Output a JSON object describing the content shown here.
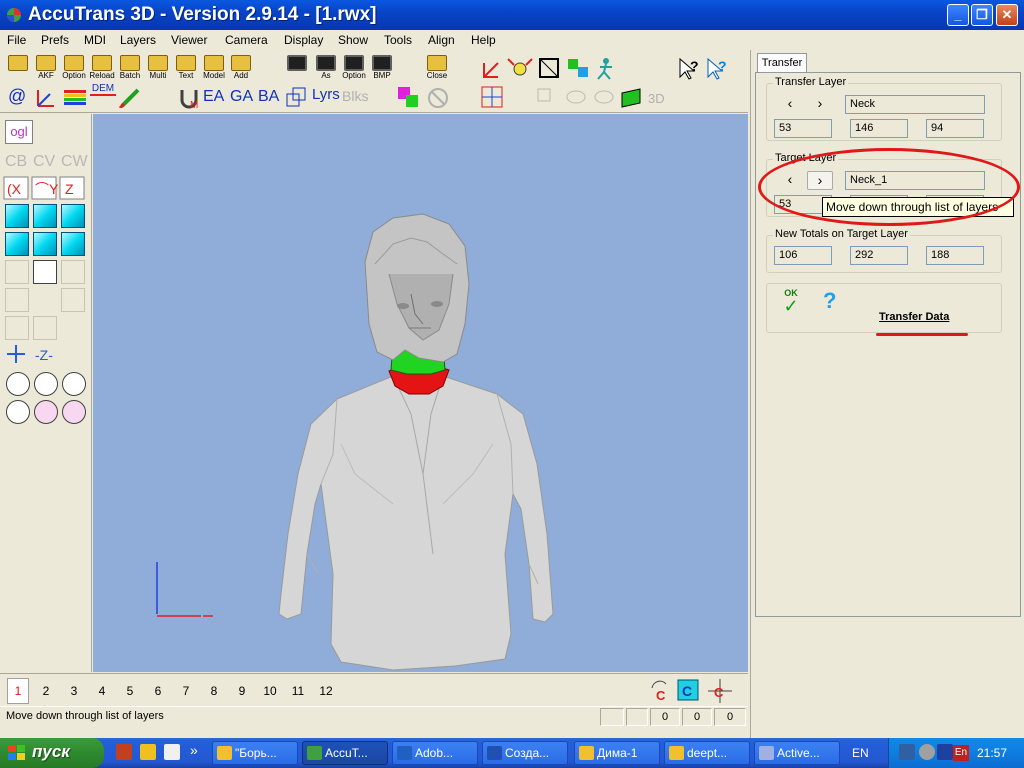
{
  "window": {
    "title": "AccuTrans 3D - Version 2.9.14 - [1.rwx]",
    "min": "_",
    "max": "❐",
    "close": "✕"
  },
  "menu": [
    "File",
    "Prefs",
    "MDI",
    "Layers",
    "Viewer",
    "Camera",
    "Display",
    "Show",
    "Tools",
    "Align",
    "Help"
  ],
  "toolbar": {
    "row1": [
      {
        "label": "",
        "icon": "open-folder-icon",
        "color": "#e8c040"
      },
      {
        "label": "AKF",
        "icon": "open-folder-icon",
        "color": "#e8c040"
      },
      {
        "label": "Option",
        "icon": "open-folder-icon",
        "color": "#e8c040"
      },
      {
        "label": "Reload",
        "icon": "open-folder-icon",
        "color": "#e8c040"
      },
      {
        "label": "Batch",
        "icon": "open-folder-icon",
        "color": "#e8c040"
      },
      {
        "label": "Multi",
        "icon": "open-folder-icon",
        "color": "#e8c040"
      },
      {
        "label": "Text",
        "icon": "open-folder-icon",
        "color": "#e8c040"
      },
      {
        "label": "Model",
        "icon": "open-folder-icon",
        "color": "#e8c040"
      },
      {
        "label": "Add",
        "icon": "open-folder-icon",
        "color": "#e8c040"
      },
      {
        "label": "",
        "icon": "save-disk-icon",
        "color": "#202020"
      },
      {
        "label": "As",
        "icon": "save-disk-icon",
        "color": "#202020"
      },
      {
        "label": "Option",
        "icon": "save-disk-icon",
        "color": "#202020"
      },
      {
        "label": "BMP",
        "icon": "save-disk-icon",
        "color": "#202020"
      },
      {
        "label": "Close",
        "icon": "close-folder-icon",
        "color": "#e8c040"
      }
    ],
    "row2_text": [
      "EA",
      "GA",
      "BA"
    ],
    "dem_label": "DEM",
    "lyrs_label": "Lyrs",
    "blks_label": "Blks",
    "label_3d": "3D"
  },
  "left_tools": {
    "ogl": "ogl"
  },
  "transfer_panel": {
    "tab": "Transfer",
    "transfer_layer": {
      "label": "Transfer Layer",
      "prev": "‹",
      "next": "›",
      "name": "Neck",
      "values": [
        "53",
        "146",
        "94"
      ]
    },
    "target_layer": {
      "label": "Target Layer",
      "prev": "‹",
      "next": "›",
      "name": "Neck_1",
      "values": [
        "53",
        "",
        ""
      ]
    },
    "tooltip": "Move down through list of layers",
    "new_totals": {
      "label": "New Totals on Target Layer",
      "values": [
        "106",
        "292",
        "188"
      ]
    },
    "ok_label": "OK",
    "help_label": "?",
    "transfer_data": "Transfer Data"
  },
  "pages": [
    "1",
    "2",
    "3",
    "4",
    "5",
    "6",
    "7",
    "8",
    "9",
    "10",
    "11",
    "12"
  ],
  "status": {
    "text": "Move down through list of layers",
    "values": [
      "0",
      "0",
      "0"
    ]
  },
  "taskbar": {
    "start": "пуск",
    "tasks": [
      "\"Борь...",
      "AccuT...",
      "Adob...",
      "Созда...",
      "Дима-1",
      "deept...",
      "Active..."
    ],
    "lang": "EN",
    "tray_lang": "En",
    "clock": "21:57",
    "expand": "»"
  }
}
